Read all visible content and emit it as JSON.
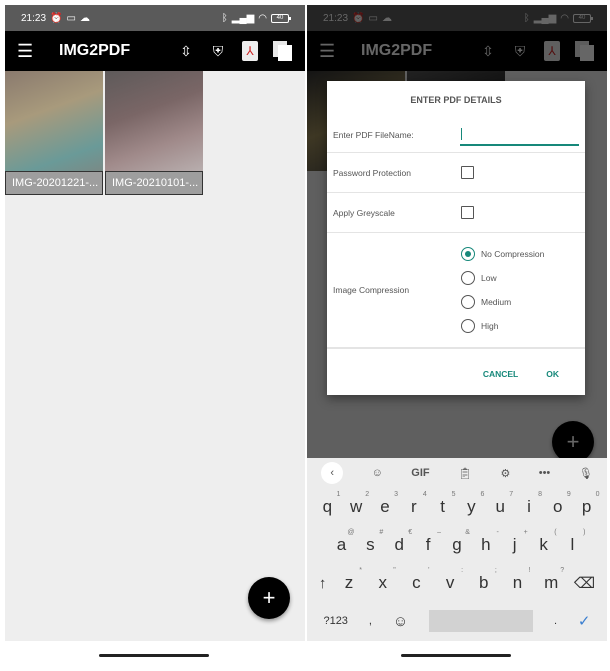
{
  "status": {
    "time": "21:23",
    "battery": "40"
  },
  "app": {
    "title": "IMG2PDF",
    "menu_icon": "menu-icon",
    "icons": [
      "sort-icon",
      "shield-x-icon",
      "pdf-icon",
      "copy-icon"
    ]
  },
  "thumbs": [
    {
      "caption": "IMG-20201221-..."
    },
    {
      "caption": "IMG-20210101-..."
    }
  ],
  "fab": {
    "label": "+"
  },
  "dialog": {
    "title": "ENTER PDF DETAILS",
    "filename_label": "Enter PDF FileName:",
    "filename_value": "",
    "password_label": "Password Protection",
    "password_checked": false,
    "greyscale_label": "Apply Greyscale",
    "greyscale_checked": false,
    "compression_label": "Image Compression",
    "compression_options": [
      "No Compression",
      "Low",
      "Medium",
      "High"
    ],
    "compression_selected": "No Compression",
    "cancel": "CANCEL",
    "ok": "OK"
  },
  "keyboard": {
    "toolbar": {
      "gif": "GIF",
      "more": "•••"
    },
    "row1": [
      [
        "q",
        "1"
      ],
      [
        "w",
        "2"
      ],
      [
        "e",
        "3"
      ],
      [
        "r",
        "4"
      ],
      [
        "t",
        "5"
      ],
      [
        "y",
        "6"
      ],
      [
        "u",
        "7"
      ],
      [
        "i",
        "8"
      ],
      [
        "o",
        "9"
      ],
      [
        "p",
        "0"
      ]
    ],
    "row2": [
      [
        "a",
        "@"
      ],
      [
        "s",
        "#"
      ],
      [
        "d",
        "€"
      ],
      [
        "f",
        "–"
      ],
      [
        "g",
        "&"
      ],
      [
        "h",
        "-"
      ],
      [
        "j",
        "+"
      ],
      [
        "k",
        "("
      ],
      [
        "l",
        ")"
      ]
    ],
    "row3": [
      [
        "z",
        "*"
      ],
      [
        "x",
        "\""
      ],
      [
        "c",
        "'"
      ],
      [
        "v",
        ":"
      ],
      [
        "b",
        ";"
      ],
      [
        "n",
        "!"
      ],
      [
        "m",
        "?"
      ]
    ],
    "symbols": "?123",
    "comma": ",",
    "period": "."
  },
  "colors": {
    "accent": "#16887a",
    "toolbar": "#000000"
  }
}
